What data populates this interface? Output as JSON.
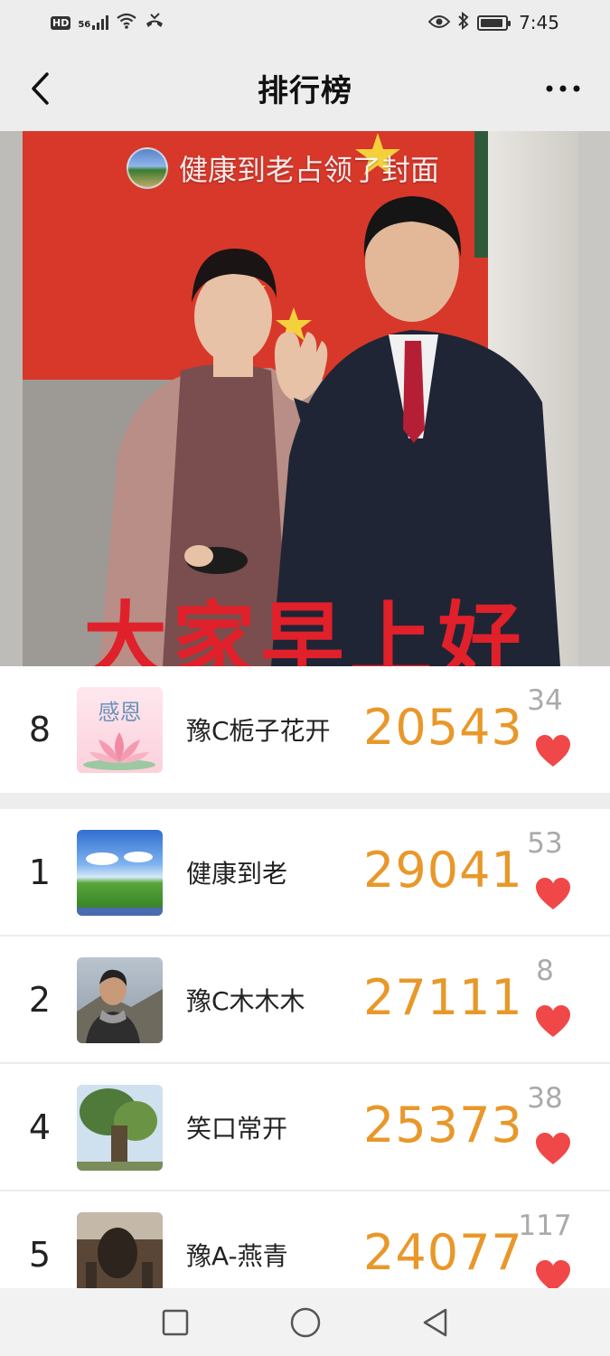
{
  "status_bar": {
    "hd": "HD",
    "signal": "56",
    "time": "7:45"
  },
  "header": {
    "title": "排行榜"
  },
  "cover": {
    "covered_by_text": "健康到老占领了封面",
    "caption": "大家早上好"
  },
  "my_entry": {
    "rank": "8",
    "avatar_text": "感恩",
    "name": "豫C栀子花开",
    "steps": "20543",
    "likes": "34"
  },
  "rankings": [
    {
      "rank": "1",
      "name": "健康到老",
      "steps": "29041",
      "likes": "53"
    },
    {
      "rank": "2",
      "name": "豫C木木木",
      "steps": "27111",
      "likes": "8"
    },
    {
      "rank": "4",
      "name": "笑口常开",
      "steps": "25373",
      "likes": "38"
    },
    {
      "rank": "5",
      "name": "豫A-燕青",
      "steps": "24077",
      "likes": "117"
    }
  ],
  "colors": {
    "steps": "#e8982a",
    "heart": "#f04848",
    "caption": "#e0202a"
  }
}
